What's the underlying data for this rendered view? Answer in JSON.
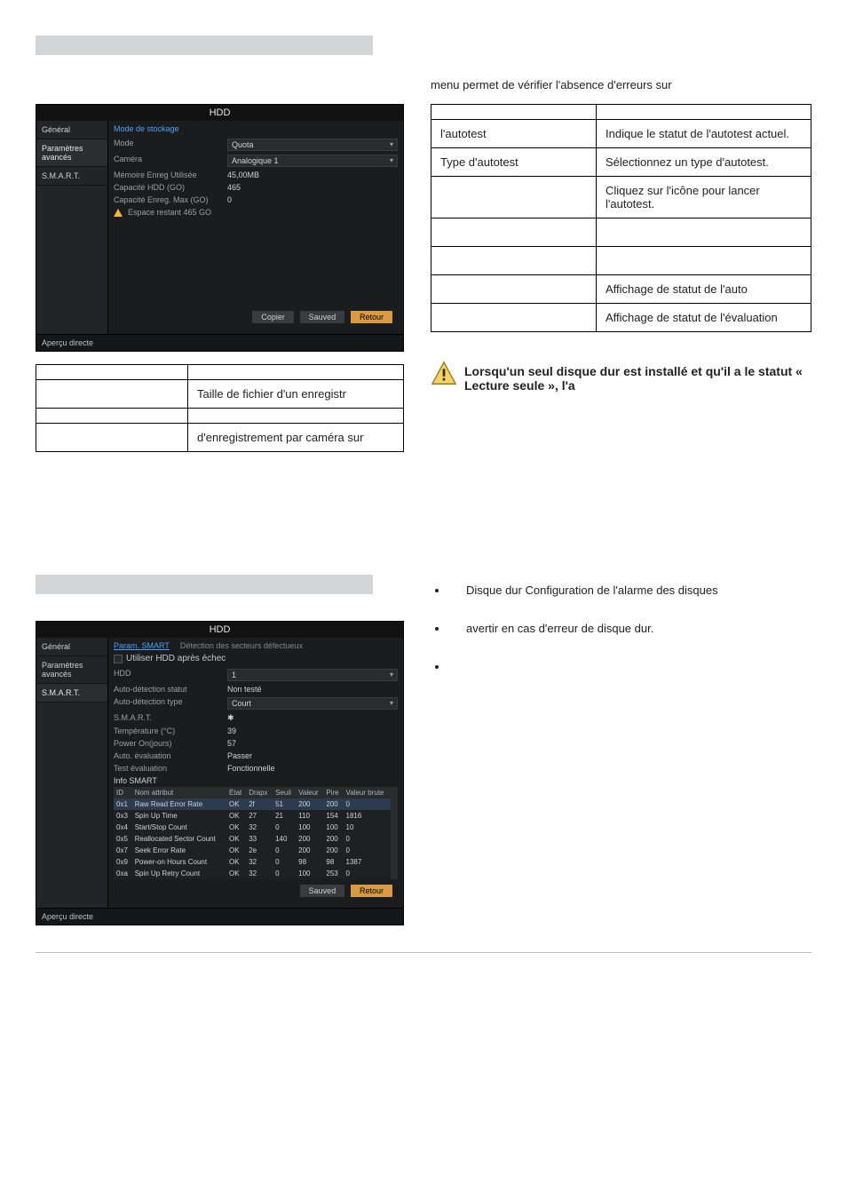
{
  "desc_right_text": "menu permet de vérifier l'absence d'erreurs sur",
  "dvr1": {
    "title": "HDD",
    "side": {
      "g": "Général",
      "pa": "Paramètres avancés",
      "sm": "S.M.A.R.T."
    },
    "section_header": "Mode de stockage",
    "footer_label": "Aperçu directe",
    "rows": {
      "mode_lbl": "Mode",
      "mode_val": "Quota",
      "cam_lbl": "Caméra",
      "cam_val": "Analogique 1",
      "mem_lbl": "Mémoire Enreg Utilisée",
      "mem_val": "45,00MB",
      "cap_lbl": "Capacité HDD (GO)",
      "cap_val": "465",
      "capmax_lbl": "Capacité Enreg. Max (GO)",
      "capmax_val": "0",
      "warn": "Espace restant 465 GO"
    },
    "buttons": {
      "cop": "Copier",
      "sav": "Sauved",
      "ret": "Retour"
    }
  },
  "left_table": {
    "r1": "Taille de fichier d'un enregistr",
    "r2": "d'enregistrement par caméra sur"
  },
  "right_table": {
    "r1l": "l'autotest",
    "r1r": "Indique le statut de l'autotest actuel.",
    "r2l": "Type d'autotest",
    "r2r": "Sélectionnez un type d'autotest.",
    "r3r": "Cliquez sur l'icône pour lancer l'autotest.",
    "r6r": "Affichage de statut de l'auto",
    "r7r": "Affichage de statut de l'évaluation"
  },
  "warn_note": "Lorsqu'un seul disque dur est installé et qu'il a le statut « Lecture seule », l'a",
  "bullets": {
    "b1": "Disque dur Configuration de l'alarme des disques",
    "b2": "avertir en cas d'erreur de disque dur."
  },
  "dvr2": {
    "title": "HDD",
    "side": {
      "g": "Général",
      "pa": "Paramètres avancés",
      "sm": "S.M.A.R.T."
    },
    "tabs": {
      "t1": "Param. SMART",
      "t2": "Détection des secteurs défectueux"
    },
    "chk": "Utiliser HDD après échec",
    "footer_label": "Aperçu directe",
    "rows": {
      "hdd_lbl": "HDD",
      "hdd_val": "1",
      "stat_lbl": "Auto-détection statut",
      "stat_val": "Non testé",
      "type_lbl": "Auto-détection type",
      "type_val": "Court",
      "smart_lbl": "S.M.A.R.T.",
      "smart_val": "",
      "temp_lbl": "Température (°C)",
      "temp_val": "39",
      "pow_lbl": "Power On(jours)",
      "pow_val": "57",
      "auto_lbl": "Auto. évaluation",
      "auto_val": "Passer",
      "test_lbl": "Test évaluation",
      "test_val": "Fonctionnelle",
      "info_lbl": "Info SMART"
    },
    "headers": {
      "id": "ID",
      "name": "Nom attribut",
      "stat": "État",
      "flags": "Drapx",
      "thr": "Seuil",
      "val": "Valeur",
      "worst": "Pire",
      "raw": "Valeur brute"
    },
    "smart_rows": [
      {
        "id": "0x1",
        "name": "Raw Read Error Rate",
        "stat": "OK",
        "flags": "2f",
        "thr": "51",
        "val": "200",
        "worst": "200",
        "raw": "0"
      },
      {
        "id": "0x3",
        "name": "Spin Up Time",
        "stat": "OK",
        "flags": "27",
        "thr": "21",
        "val": "110",
        "worst": "154",
        "raw": "1816"
      },
      {
        "id": "0x4",
        "name": "Start/Stop Count",
        "stat": "OK",
        "flags": "32",
        "thr": "0",
        "val": "100",
        "worst": "100",
        "raw": "10"
      },
      {
        "id": "0x5",
        "name": "Reallocated Sector Count",
        "stat": "OK",
        "flags": "33",
        "thr": "140",
        "val": "200",
        "worst": "200",
        "raw": "0"
      },
      {
        "id": "0x7",
        "name": "Seek Error Rate",
        "stat": "OK",
        "flags": "2e",
        "thr": "0",
        "val": "200",
        "worst": "200",
        "raw": "0"
      },
      {
        "id": "0x9",
        "name": "Power-on Hours Count",
        "stat": "OK",
        "flags": "32",
        "thr": "0",
        "val": "98",
        "worst": "98",
        "raw": "1387"
      },
      {
        "id": "0xa",
        "name": "Spin Up Retry Count",
        "stat": "OK",
        "flags": "32",
        "thr": "0",
        "val": "100",
        "worst": "253",
        "raw": "0"
      }
    ],
    "buttons": {
      "sav": "Sauved",
      "ret": "Retour"
    }
  }
}
